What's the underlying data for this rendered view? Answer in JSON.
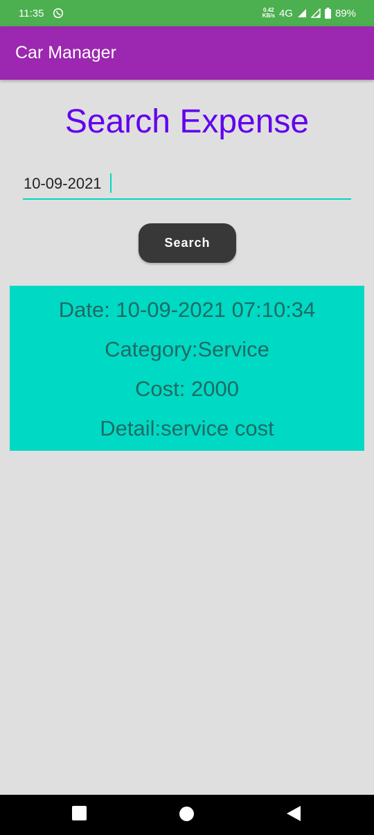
{
  "status_bar": {
    "time": "11:35",
    "net_speed_value": "0.42",
    "net_speed_unit": "KB/s",
    "network": "4G",
    "battery": "89%",
    "icons": [
      "whatsapp-icon",
      "signal-icon",
      "signal-icon",
      "battery-icon"
    ],
    "color": "#4caf50"
  },
  "app_bar": {
    "title": "Car Manager",
    "color": "#9c27b0"
  },
  "main": {
    "title": "Search Expense",
    "title_color": "#6200ee",
    "date_input_value": "10-09-2021",
    "search_button_label": "Search"
  },
  "result": {
    "date": "Date: 10-09-2021 07:10:34",
    "category": "Category:Service",
    "cost": "Cost: 2000",
    "detail": "Detail:service cost",
    "background": "#00d9c4"
  },
  "nav_bar": {
    "icons": [
      "recents-square-icon",
      "home-circle-icon",
      "back-triangle-icon"
    ]
  }
}
